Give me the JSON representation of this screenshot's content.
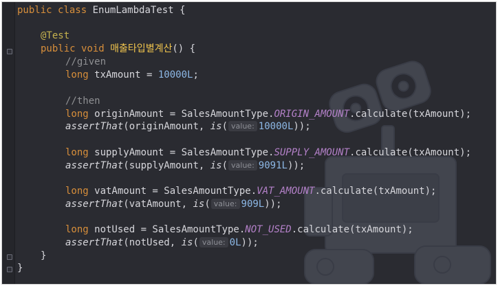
{
  "code": {
    "class_decl": {
      "kw1": "public",
      "kw2": "class",
      "name": "EnumLambdaTest",
      "brace": "{"
    },
    "annotation": "@Test",
    "method_decl": {
      "kw1": "public",
      "kw2": "void",
      "name": "매출타입별계산",
      "sig": "() {"
    },
    "given_comment": "//given",
    "tx_line": {
      "type": "long",
      "rest": " txAmount = ",
      "value": "10000L",
      "end": ";"
    },
    "then_comment": "//then",
    "blocks": [
      {
        "type": "long",
        "var": " originAmount = SalesAmountType.",
        "const": "ORIGIN_AMOUNT",
        "call": ".calculate(txAmount);",
        "assert": "assertThat",
        "assert_arg": "(originAmount, ",
        "is": "is",
        "open": "(",
        "hint": "value:",
        "value": "10000L",
        "close": "));"
      },
      {
        "type": "long",
        "var": " supplyAmount = SalesAmountType.",
        "const": "SUPPLY_AMOUNT",
        "call": ".calculate(txAmount);",
        "assert": "assertThat",
        "assert_arg": "(supplyAmount, ",
        "is": "is",
        "open": "(",
        "hint": "value:",
        "value": "9091L",
        "close": "));"
      },
      {
        "type": "long",
        "var": " vatAmount = SalesAmountType.",
        "const": "VAT_AMOUNT",
        "call": ".calculate(txAmount);",
        "assert": "assertThat",
        "assert_arg": "(vatAmount, ",
        "is": "is",
        "open": "(",
        "hint": "value:",
        "value": "909L",
        "close": "));"
      },
      {
        "type": "long",
        "var": " notUsed = SalesAmountType.",
        "const": "NOT_USED",
        "call": ".calculate(txAmount);",
        "assert": "assertThat",
        "assert_arg": "(notUsed, ",
        "is": "is",
        "open": "(",
        "hint": "value:",
        "value": "0L",
        "close": "));"
      }
    ],
    "method_close": "}",
    "class_close": "}"
  },
  "colors": {
    "background": "#2a2b31",
    "keyword": "#d88f3b",
    "number": "#8db8e6",
    "constant": "#b481c9",
    "annotation": "#c6b24e",
    "comment": "#8f9093"
  },
  "background_image": "wall-e-robot"
}
